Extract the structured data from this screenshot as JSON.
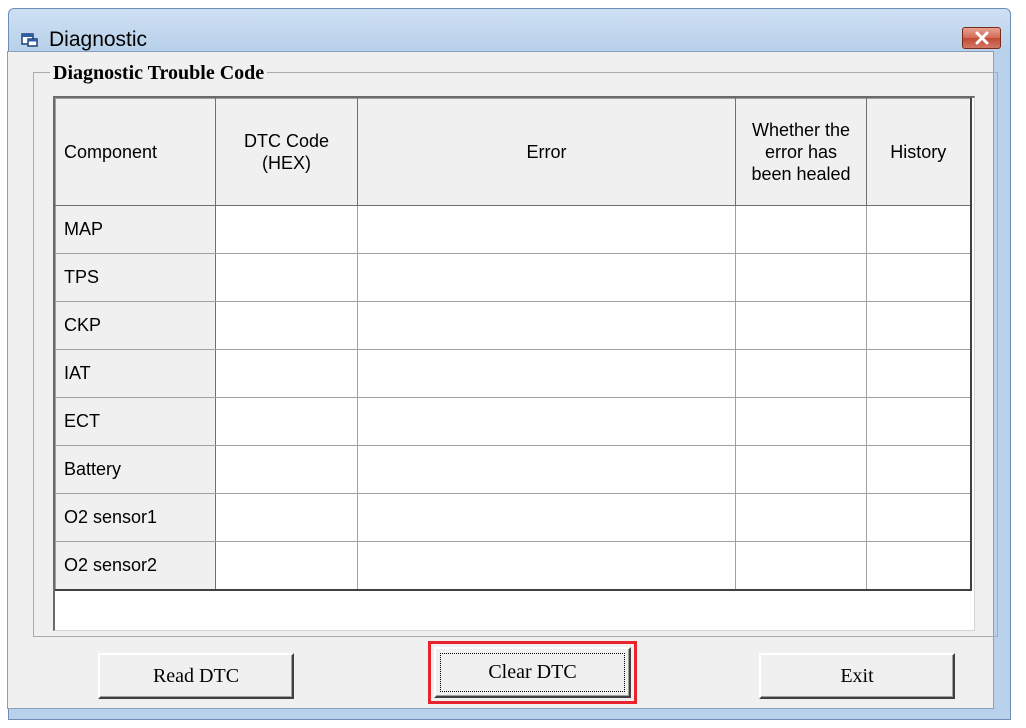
{
  "window": {
    "title": "Diagnostic",
    "icon": "app-window-icon",
    "close_icon": "close-x-icon",
    "close_color": "#c9503a"
  },
  "groupbox": {
    "label": "Diagnostic Trouble Code"
  },
  "table": {
    "columns": [
      "Component",
      "DTC Code\n(HEX)",
      "Error",
      "Whether the\nerror has\nbeen healed",
      "History"
    ],
    "rows": [
      {
        "component": "MAP",
        "dtc_code": "",
        "error": "",
        "healed": "",
        "history": ""
      },
      {
        "component": "TPS",
        "dtc_code": "",
        "error": "",
        "healed": "",
        "history": ""
      },
      {
        "component": "CKP",
        "dtc_code": "",
        "error": "",
        "healed": "",
        "history": ""
      },
      {
        "component": "IAT",
        "dtc_code": "",
        "error": "",
        "healed": "",
        "history": ""
      },
      {
        "component": "ECT",
        "dtc_code": "",
        "error": "",
        "healed": "",
        "history": ""
      },
      {
        "component": "Battery",
        "dtc_code": "",
        "error": "",
        "healed": "",
        "history": ""
      },
      {
        "component": "O2 sensor1",
        "dtc_code": "",
        "error": "",
        "healed": "",
        "history": ""
      },
      {
        "component": "O2 sensor2",
        "dtc_code": "",
        "error": "",
        "healed": "",
        "history": ""
      }
    ]
  },
  "buttons": {
    "read": "Read DTC",
    "clear": "Clear DTC",
    "exit": "Exit"
  },
  "colors": {
    "highlight": "#e8232b",
    "title_gradient_top": "#cfe0f3",
    "face": "#f0f0f0"
  }
}
